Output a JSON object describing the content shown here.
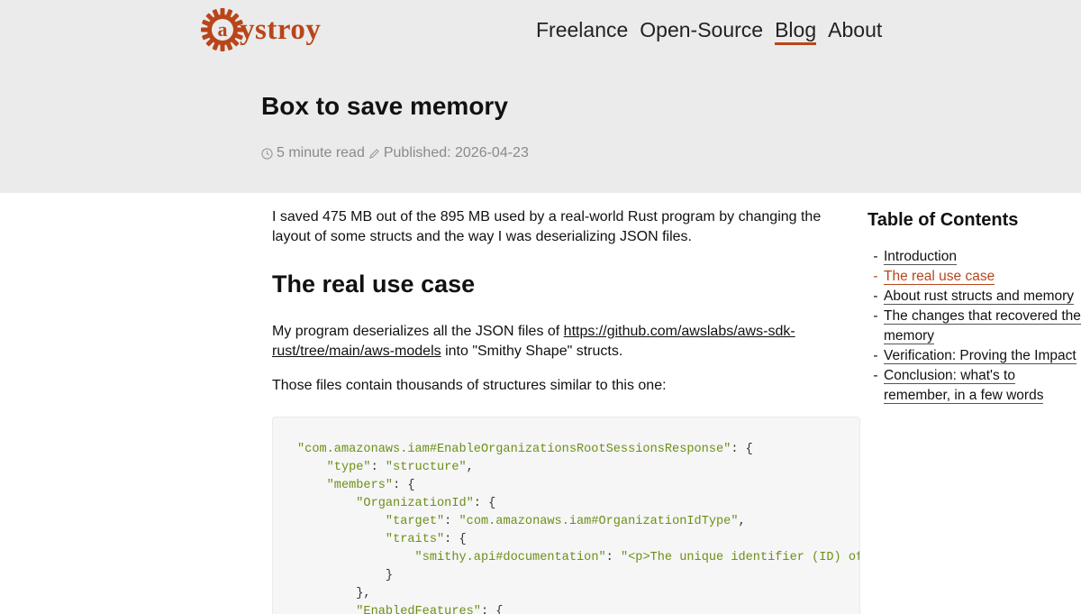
{
  "brand": {
    "name": "ystroy",
    "accent": "#b8461a"
  },
  "nav": [
    {
      "label": "Freelance",
      "active": false
    },
    {
      "label": "Open-Source",
      "active": false
    },
    {
      "label": "Blog",
      "active": true
    },
    {
      "label": "About",
      "active": false
    }
  ],
  "post": {
    "title": "Box to save memory",
    "read_time": "5 minute read",
    "published": "Published: 2026-04-23",
    "intro": "I saved 475 MB out of the 895 MB used by a real-world Rust program by changing the layout of some structs and the way I was deserializing JSON files.",
    "section_heading": "The real use case",
    "para1_before": "My program deserializes all the JSON files of ",
    "para1_link": "https://github.com/awslabs/aws-sdk-rust/tree/main/aws-models",
    "para1_after": " into \"Smithy Shape\" structs.",
    "para2": "Those files contain thousands of structures similar to this one:"
  },
  "code": {
    "l1_key": "\"com.amazonaws.iam#EnableOrganizationsRootSessionsResponse\"",
    "l1_rest": ": {",
    "l2_key": "\"type\"",
    "l2_val": "\"structure\"",
    "l3_key": "\"members\"",
    "l4_key": "\"OrganizationId\"",
    "l5_key": "\"target\"",
    "l5_val": "\"com.amazonaws.iam#OrganizationIdType\"",
    "l6_key": "\"traits\"",
    "l7_key": "\"smithy.api#documentation\"",
    "l7_val": "\"<p>The unique identifier (ID) of an",
    "l8": "}",
    "l9": "},",
    "l10_key": "\"EnabledFeatures\""
  },
  "toc": {
    "title": "Table of Contents",
    "items": [
      {
        "label": "Introduction",
        "current": false
      },
      {
        "label": "The real use case",
        "current": true
      },
      {
        "label": "About rust structs and memory",
        "current": false
      },
      {
        "label": "The changes that recovered the memory",
        "current": false
      },
      {
        "label": "Verification: Proving the Impact",
        "current": false
      },
      {
        "label": "Conclusion: what's to remember, in a few words",
        "current": false
      }
    ]
  }
}
